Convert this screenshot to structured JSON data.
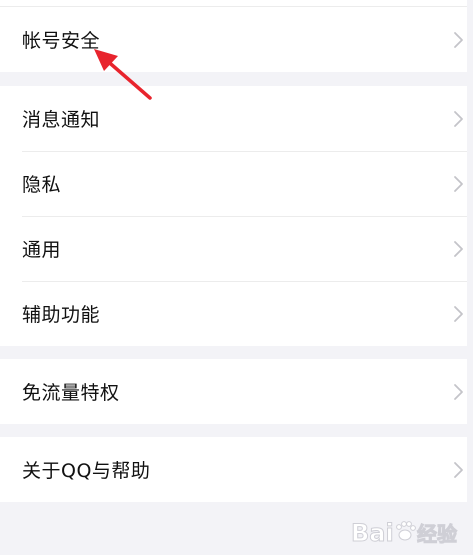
{
  "settings": {
    "groups": [
      {
        "items": [
          {
            "label": "帐号安全"
          }
        ]
      },
      {
        "items": [
          {
            "label": "消息通知"
          },
          {
            "label": "隐私"
          },
          {
            "label": "通用"
          },
          {
            "label": "辅助功能"
          }
        ]
      },
      {
        "items": [
          {
            "label": "免流量特权"
          }
        ]
      },
      {
        "items": [
          {
            "label": "关于QQ与帮助"
          }
        ]
      }
    ]
  },
  "watermark": {
    "brand": "Bai",
    "suffix": "经验"
  },
  "colors": {
    "background": "#f3f3f7",
    "row": "#ffffff",
    "text": "#111111",
    "chevron": "#c4c4c9",
    "arrow": "#e8242d"
  }
}
